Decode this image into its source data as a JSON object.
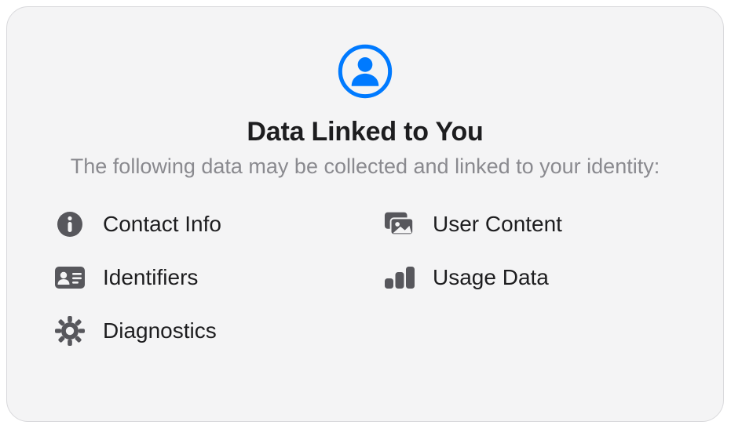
{
  "title": "Data Linked to You",
  "subtitle": "The following data may be collected and linked to your identity:",
  "items": [
    {
      "label": "Contact Info"
    },
    {
      "label": "User Content"
    },
    {
      "label": "Identifiers"
    },
    {
      "label": "Usage Data"
    },
    {
      "label": "Diagnostics"
    }
  ]
}
